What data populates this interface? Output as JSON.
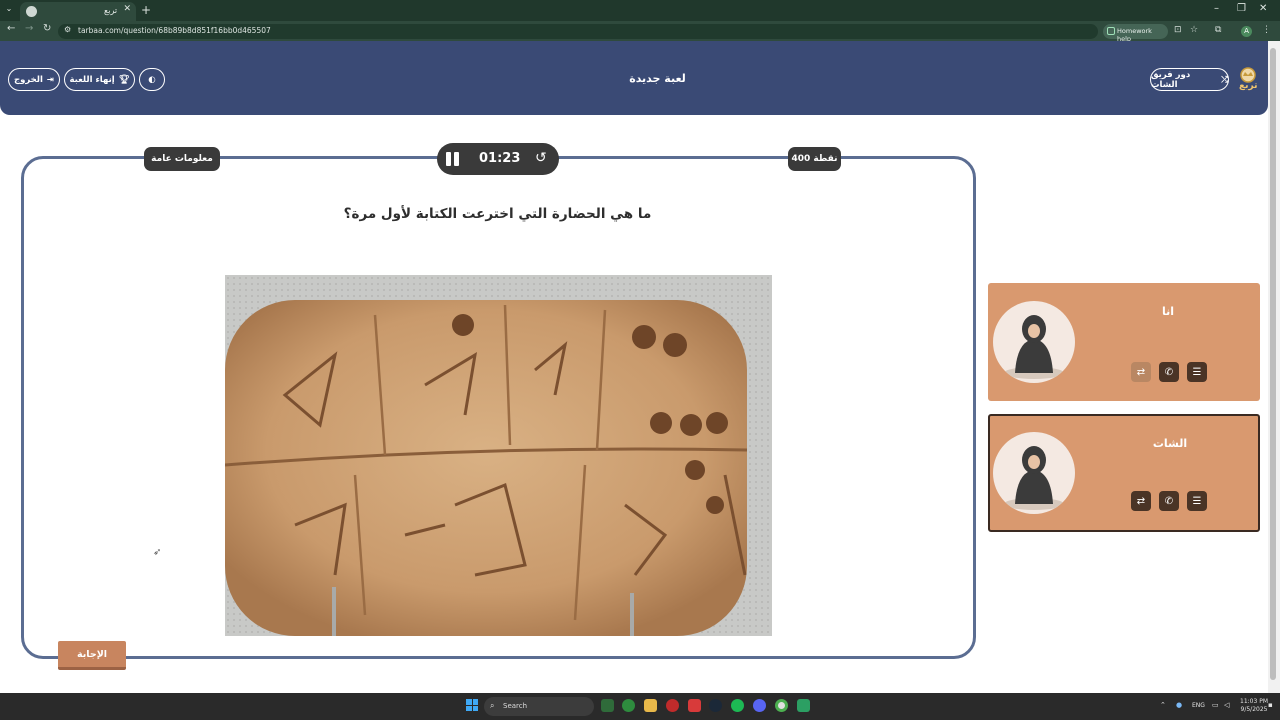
{
  "browser": {
    "tab_title": "تربع",
    "url": "tarbaa.com/question/68b89b8d851f16bb0d465507",
    "homework_help": "Homework help",
    "profile_initial": "A"
  },
  "header": {
    "title": "لعبة جديدة",
    "exit_label": "الخروج",
    "end_game_label": "إنهاء اللعبة",
    "team_role_label": "دور فريق الشات",
    "logo_text": "تربع"
  },
  "question": {
    "category": "معلومات عامة",
    "points": "400 نقطة",
    "timer": "01:23",
    "text": "ما هي الحضارة التي اخترعت الكتابة لأول مرة؟",
    "answer_label": "الإجابة"
  },
  "teams": [
    {
      "name": "انا"
    },
    {
      "name": "الشات"
    }
  ],
  "taskbar": {
    "search_placeholder": "Search",
    "language": "ENG",
    "time": "11:03 PM",
    "date": "9/5/2025"
  },
  "colors": {
    "header_bg": "#3a4a75",
    "card_border": "#5b6d92",
    "team_card": "#d9996f",
    "answer_button": "#c8855f"
  }
}
